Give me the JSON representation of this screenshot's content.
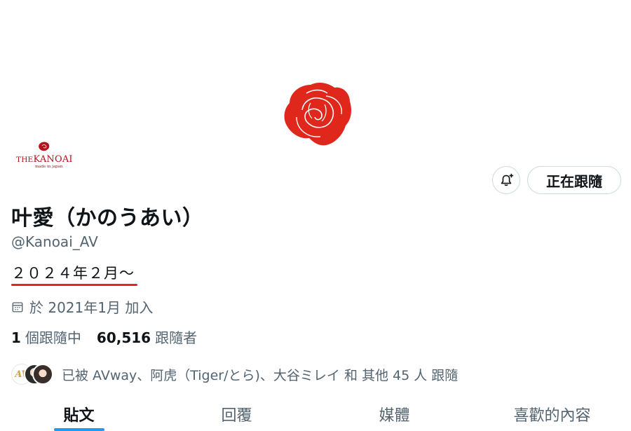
{
  "profile": {
    "display_name": "叶愛（かのうあい）",
    "handle": "@Kanoai_AV",
    "bio": "２０２４年２月～",
    "joined": "於 2021年1月 加入",
    "avatar_brand_pre": "THE",
    "avatar_brand_main": "KANOAI",
    "avatar_tagline": "made in japan"
  },
  "actions": {
    "follow_label": "正在跟隨"
  },
  "stats": {
    "following_count": "1",
    "following_label": "個跟隨中",
    "followers_count": "60,516",
    "followers_label": "跟隨者"
  },
  "followed_by": {
    "text": "已被 AVway、阿虎（Tiger/とら)、大谷ミレイ 和 其他 45 人 跟隨",
    "first_avatar_text": "AV"
  },
  "tabs": [
    {
      "label": "貼文",
      "active": true
    },
    {
      "label": "回覆",
      "active": false
    },
    {
      "label": "媒體",
      "active": false
    },
    {
      "label": "喜歡的內容",
      "active": false
    }
  ],
  "colors": {
    "accent": "#1d9bf0",
    "rose": "#e0271b",
    "text_primary": "#0f1419",
    "text_secondary": "#536471",
    "border": "#cfd9de"
  },
  "icons": {
    "banner": "rose-logo-icon",
    "notify": "bell-plus-icon",
    "joined": "calendar-icon"
  }
}
